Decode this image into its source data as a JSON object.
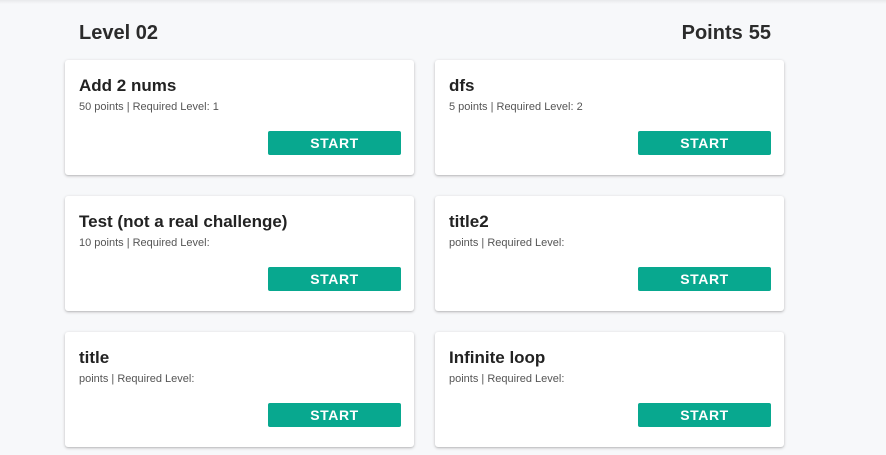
{
  "header": {
    "level_label": "Level 02",
    "points_label": "Points",
    "points_value": "55"
  },
  "challenges": [
    {
      "title": "Add 2 nums",
      "meta": "50 points | Required Level: 1",
      "button": "START"
    },
    {
      "title": "dfs",
      "meta": "5 points | Required Level: 2",
      "button": "START"
    },
    {
      "title": "Test (not a real challenge)",
      "meta": "10 points | Required Level:",
      "button": "START"
    },
    {
      "title": "title2",
      "meta": "points | Required Level:",
      "button": "START"
    },
    {
      "title": "title",
      "meta": "points | Required Level:",
      "button": "START"
    },
    {
      "title": "Infinite loop",
      "meta": "points | Required Level:",
      "button": "START"
    }
  ],
  "colors": {
    "accent": "#08a88f",
    "background": "#f7f8fa",
    "card": "#ffffff"
  }
}
